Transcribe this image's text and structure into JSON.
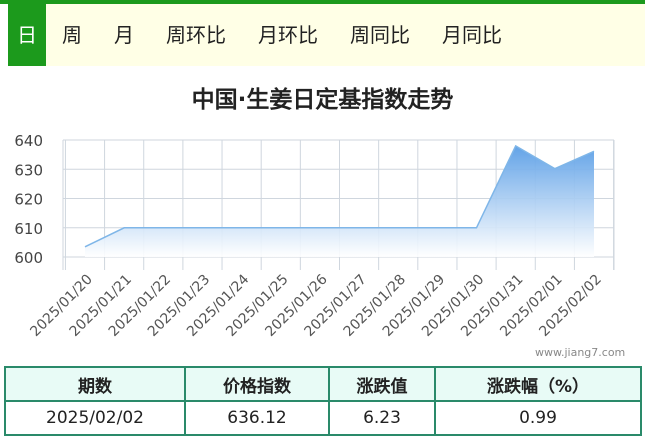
{
  "tabs": [
    {
      "label": "日",
      "active": true
    },
    {
      "label": "周",
      "active": false
    },
    {
      "label": "月",
      "active": false
    },
    {
      "label": "周环比",
      "active": false
    },
    {
      "label": "月环比",
      "active": false
    },
    {
      "label": "周同比",
      "active": false
    },
    {
      "label": "月同比",
      "active": false
    }
  ],
  "watermark": "www.jiang7.com",
  "colors": {
    "accent": "#1c9a1c",
    "line": "#7fb6e8",
    "table_border": "#2a8a6a",
    "header_bg": "#e8fbf6"
  },
  "chart_data": {
    "type": "area",
    "title": "中国·生姜日定基指数走势",
    "x": [
      "2025/01/20",
      "2025/01/21",
      "2025/01/22",
      "2025/01/23",
      "2025/01/24",
      "2025/01/25",
      "2025/01/26",
      "2025/01/27",
      "2025/01/28",
      "2025/01/29",
      "2025/01/30",
      "2025/01/31",
      "2025/02/01",
      "2025/02/02"
    ],
    "series": [
      {
        "values": [
          603.5,
          610,
          610,
          610,
          610,
          610,
          610,
          610,
          610,
          610,
          610,
          638,
          630.2,
          636.12
        ]
      }
    ],
    "ylim": [
      600,
      640
    ],
    "yticks": [
      600,
      610,
      620,
      630,
      640
    ],
    "grid": true
  },
  "table": {
    "headers": [
      "期数",
      "价格指数",
      "涨跌值",
      "涨跌幅（%）"
    ],
    "row": [
      "2025/02/02",
      "636.12",
      "6.23",
      "0.99"
    ]
  }
}
